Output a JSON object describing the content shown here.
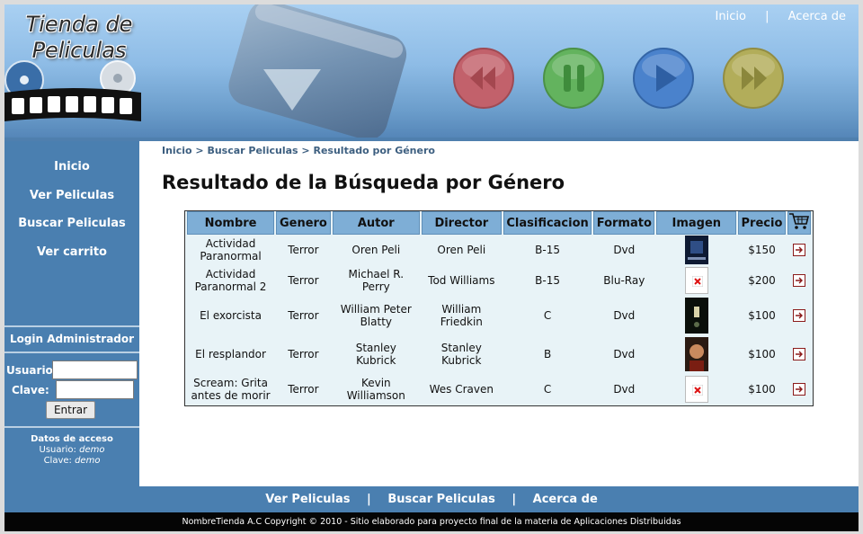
{
  "header": {
    "logo_line1": "Tienda de",
    "logo_line2": "Peliculas",
    "nav": {
      "home": "Inicio",
      "separator": "|",
      "about": "Acerca de"
    },
    "media_buttons": [
      {
        "name": "rewind-icon",
        "color": "#c2616b"
      },
      {
        "name": "pause-icon",
        "color": "#63b35e"
      },
      {
        "name": "play-icon",
        "color": "#4a82cc"
      },
      {
        "name": "fast-forward-icon",
        "color": "#b2ad5a"
      }
    ]
  },
  "sidebar": {
    "items": [
      {
        "label": "Inicio"
      },
      {
        "label": "Ver Peliculas"
      },
      {
        "label": "Buscar Peliculas"
      },
      {
        "label": "Ver carrito"
      }
    ],
    "login_title": "Login Administrador",
    "user_label": "Usuario:",
    "password_label": "Clave:",
    "user_value": "",
    "password_value": "",
    "submit_label": "Entrar",
    "access_title": "Datos de acceso",
    "access_user_label": "Usuario:",
    "access_user": "demo",
    "access_pass_label": "Clave:",
    "access_pass": "demo"
  },
  "breadcrumb": {
    "home": "Inicio",
    "sep1": ">",
    "search": "Buscar Peliculas",
    "sep2": ">",
    "current": "Resultado por Género"
  },
  "page_title": "Resultado de la Búsqueda por Género",
  "table": {
    "headers": [
      "Nombre",
      "Genero",
      "Autor",
      "Director",
      "Clasificacion",
      "Formato",
      "Imagen",
      "Precio"
    ],
    "rows": [
      {
        "nombre": "Actividad Paranormal",
        "genero": "Terror",
        "autor": "Oren Peli",
        "director": "Oren Peli",
        "clasificacion": "B-15",
        "formato": "Dvd",
        "imagen": "poster",
        "precio": "$150"
      },
      {
        "nombre": "Actividad Paranormal 2",
        "genero": "Terror",
        "autor": "Michael R. Perry",
        "director": "Tod Williams",
        "clasificacion": "B-15",
        "formato": "Blu-Ray",
        "imagen": "broken",
        "precio": "$200"
      },
      {
        "nombre": "El exorcista",
        "genero": "Terror",
        "autor": "William Peter Blatty",
        "director": "William Friedkin",
        "clasificacion": "C",
        "formato": "Dvd",
        "imagen": "poster",
        "precio": "$100"
      },
      {
        "nombre": "El resplandor",
        "genero": "Terror",
        "autor": "Stanley Kubrick",
        "director": "Stanley Kubrick",
        "clasificacion": "B",
        "formato": "Dvd",
        "imagen": "poster",
        "precio": "$100"
      },
      {
        "nombre": "Scream: Grita antes de morir",
        "genero": "Terror",
        "autor": "Kevin Williamson",
        "director": "Wes Craven",
        "clasificacion": "C",
        "formato": "Dvd",
        "imagen": "broken",
        "precio": "$100"
      }
    ]
  },
  "footer": {
    "links": [
      "Ver Peliculas",
      "Buscar Peliculas",
      "Acerca de"
    ],
    "separator": "|",
    "copyright": "NombreTienda A.C Copyright © 2010 - Sitio elaborado para proyecto final de la materia de Aplicaciones Distribuidas"
  }
}
